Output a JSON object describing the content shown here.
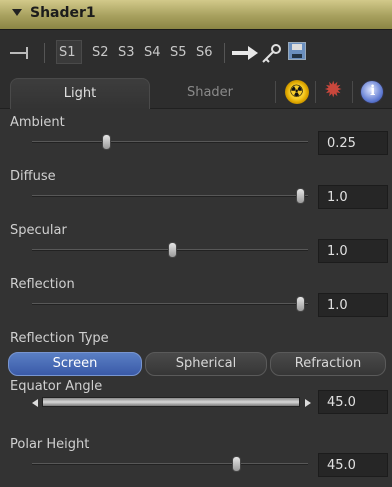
{
  "tool": {
    "name": "Shader1"
  },
  "version_bar": {
    "versions": [
      "S1",
      "S2",
      "S3",
      "S4",
      "S5",
      "S6"
    ],
    "selected": "S1",
    "icons": [
      "pin-icon",
      "arrow-icon",
      "key-icon",
      "save-icon"
    ]
  },
  "tabs": {
    "light": "Light",
    "shader": "Shader",
    "selected": "Light",
    "icons": [
      "radioactive-icon",
      "gear-icon",
      "info-icon"
    ]
  },
  "controls": {
    "ambient": {
      "label": "Ambient",
      "value": "0.25",
      "level": 0.25
    },
    "diffuse": {
      "label": "Diffuse",
      "value": "1.0",
      "level": 1.0
    },
    "specular": {
      "label": "Specular",
      "value": "1.0",
      "level": 0.5
    },
    "reflection": {
      "label": "Reflection",
      "value": "1.0",
      "level": 1.0
    },
    "reflection_type": {
      "label": "Reflection Type",
      "options": [
        "Screen",
        "Spherical",
        "Refraction"
      ],
      "selected": "Screen"
    },
    "equator_angle": {
      "label": "Equator Angle",
      "value": "45.0"
    },
    "polar_height": {
      "label": "Polar Height",
      "value": "45.0",
      "level": 0.75
    }
  },
  "colors": {
    "title_bar": "#a7a05e",
    "active_button": "#4a6bb8"
  }
}
